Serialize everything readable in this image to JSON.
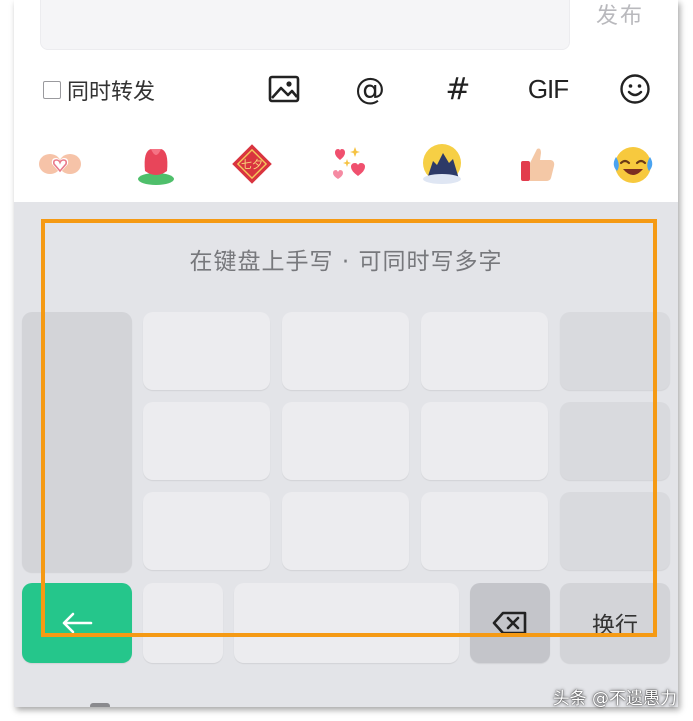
{
  "compose": {
    "publish_label": "发布"
  },
  "toolbar": {
    "repost_label": "同时转发",
    "mention_symbol": "@",
    "hashtag_symbol": "#",
    "gif_label": "GIF",
    "icons": [
      "image-icon",
      "at-icon",
      "hashtag-icon",
      "gif-icon",
      "smiley-icon"
    ]
  },
  "stickers": [
    "heart-hands",
    "tulip",
    "qixi-lantern",
    "sparkle-hearts",
    "moon-festival",
    "thumbs-up",
    "laughing-crying"
  ],
  "keyboard": {
    "hint": "在键盘上手写 · 可同时写多字",
    "enter_label": "换行",
    "back_key_icon": "left-arrow-icon",
    "delete_key_icon": "backspace-icon"
  },
  "colors": {
    "accent_green": "#25c68b",
    "highlight_orange": "#f59a14",
    "keyboard_bg": "#e3e4e8"
  },
  "watermark": "头条 @不遗愚力"
}
